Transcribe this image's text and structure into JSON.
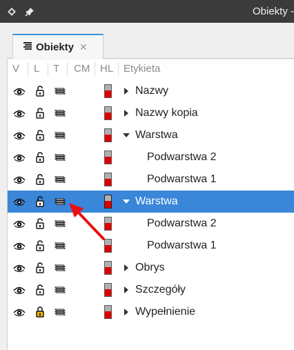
{
  "window": {
    "title": "Obiekty -"
  },
  "tab": {
    "label": "Obiekty",
    "close": "✕"
  },
  "columns": {
    "v": "V",
    "l": "L",
    "t": "T",
    "cm": "CM",
    "hl": "HL",
    "label": "Etykieta"
  },
  "colors": {
    "selection": "#3a86d9",
    "highlight_red": "#e00000",
    "annotation_arrow": "#e81010"
  },
  "rows": [
    {
      "label": "Nazwy",
      "expander": "collapsed",
      "indent": 0,
      "selected": false,
      "locked": false
    },
    {
      "label": "Nazwy kopia",
      "expander": "collapsed",
      "indent": 0,
      "selected": false,
      "locked": false
    },
    {
      "label": "Warstwa",
      "expander": "expanded",
      "indent": 0,
      "selected": false,
      "locked": false
    },
    {
      "label": "Podwarstwa 2",
      "expander": "none",
      "indent": 1,
      "selected": false,
      "locked": false
    },
    {
      "label": "Podwarstwa 1",
      "expander": "none",
      "indent": 1,
      "selected": false,
      "locked": false
    },
    {
      "label": "Warstwa",
      "expander": "expanded",
      "indent": 0,
      "selected": true,
      "locked": false
    },
    {
      "label": "Podwarstwa 2",
      "expander": "none",
      "indent": 1,
      "selected": false,
      "locked": false
    },
    {
      "label": "Podwarstwa 1",
      "expander": "none",
      "indent": 1,
      "selected": false,
      "locked": false
    },
    {
      "label": "Obrys",
      "expander": "collapsed",
      "indent": 0,
      "selected": false,
      "locked": false
    },
    {
      "label": "Szczegóły",
      "expander": "collapsed",
      "indent": 0,
      "selected": false,
      "locked": false
    },
    {
      "label": "Wypełnienie",
      "expander": "collapsed",
      "indent": 0,
      "selected": false,
      "locked": true
    }
  ]
}
